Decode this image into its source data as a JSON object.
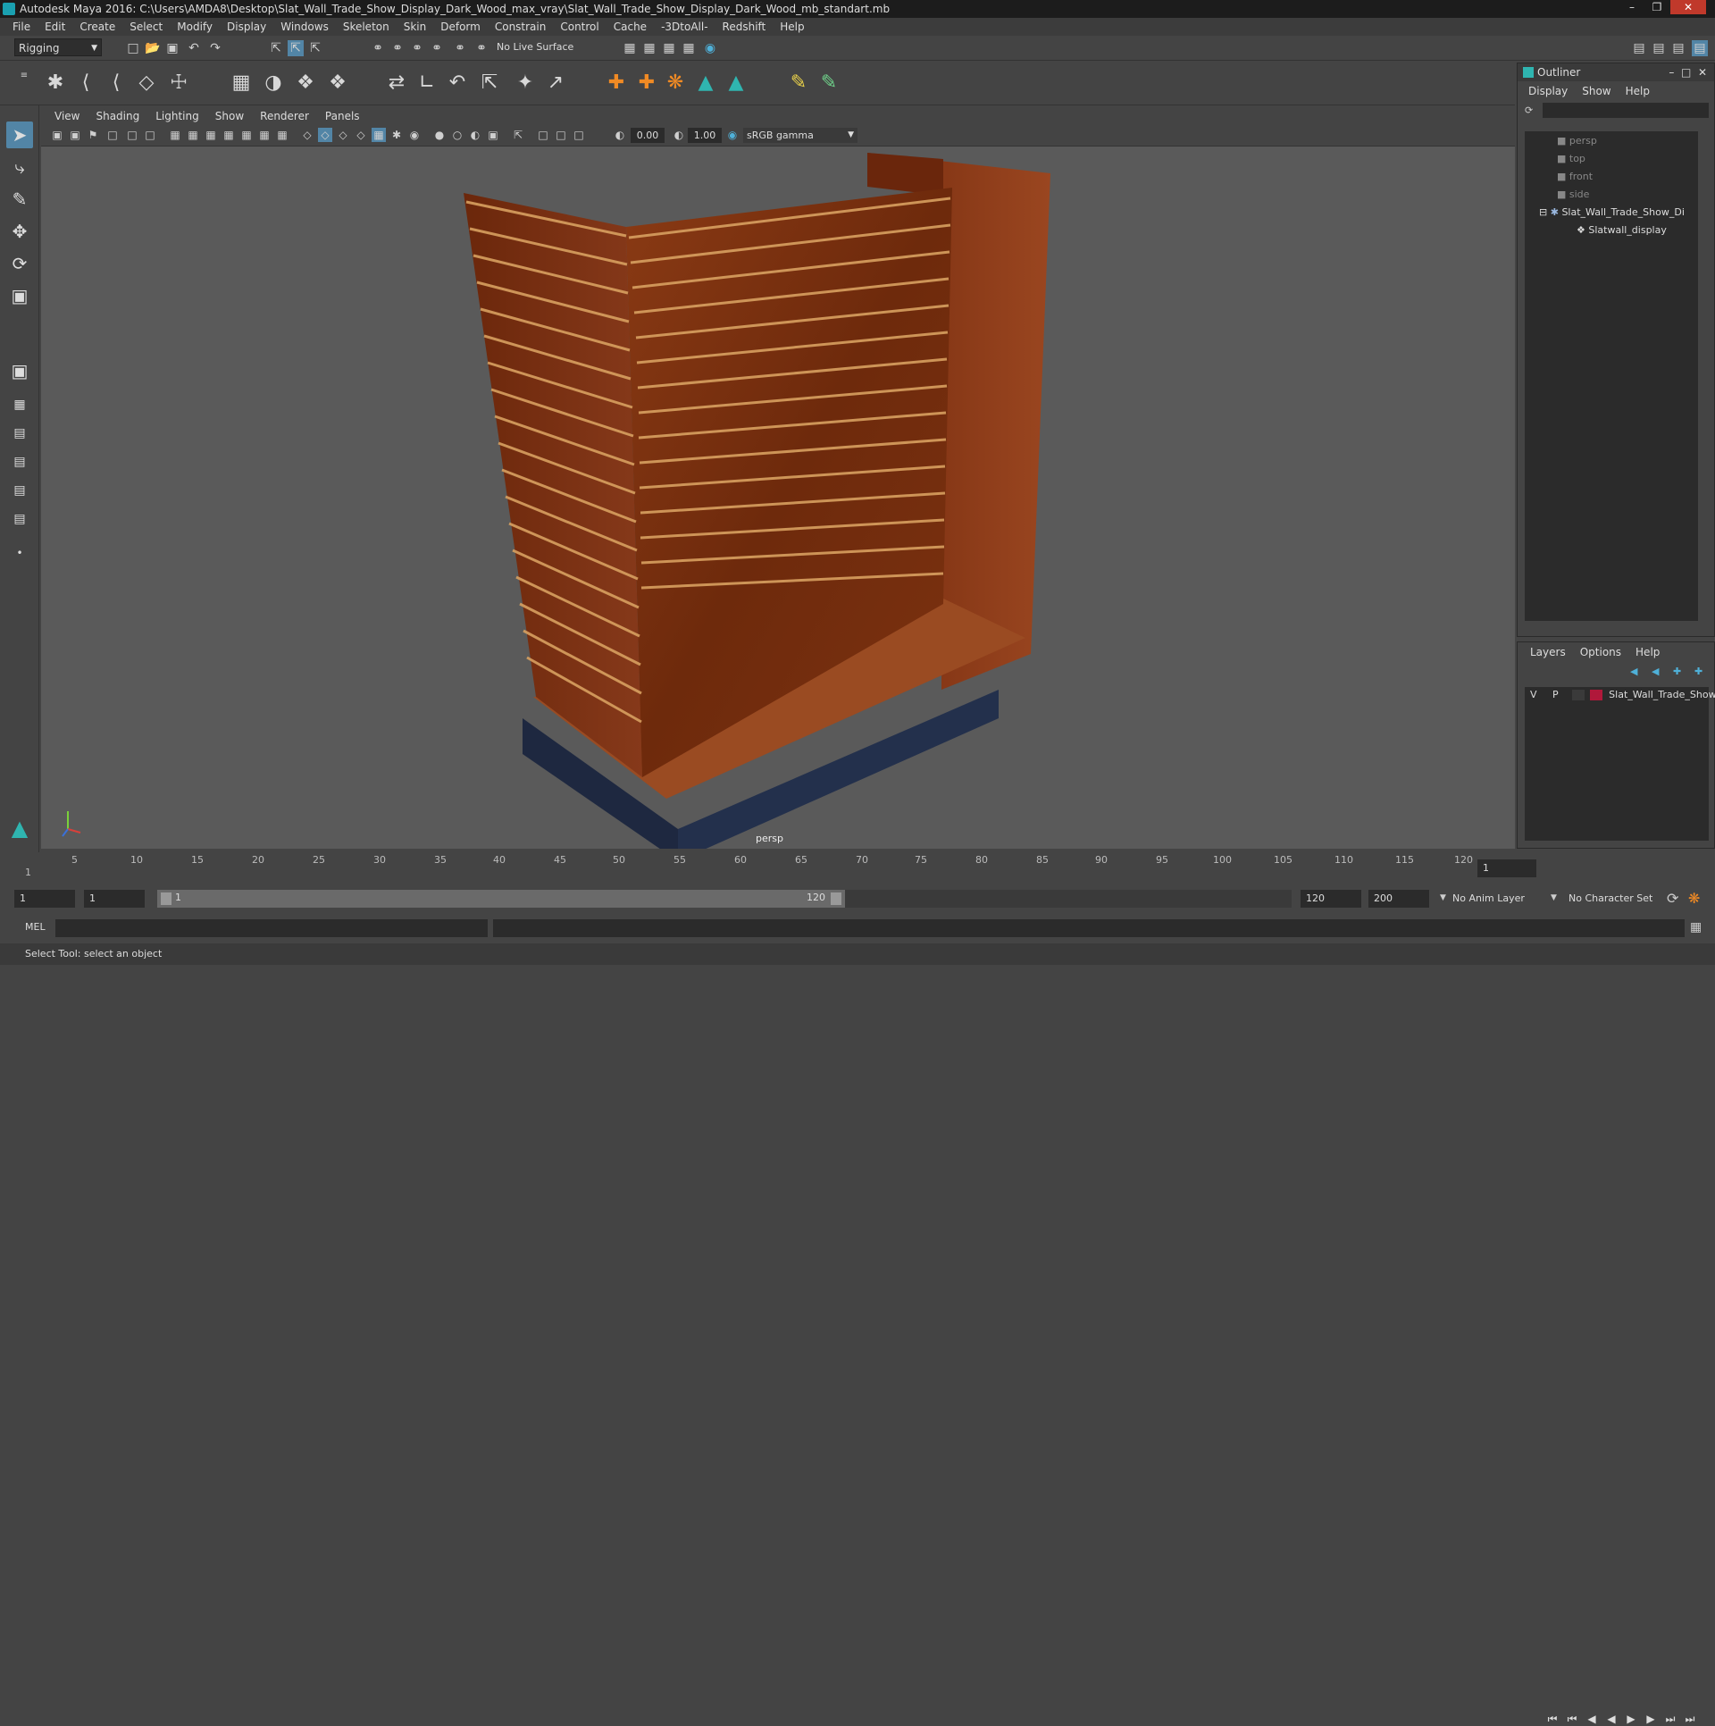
{
  "window": {
    "title": "Autodesk Maya 2016: C:\\Users\\AMDA8\\Desktop\\Slat_Wall_Trade_Show_Display_Dark_Wood_max_vray\\Slat_Wall_Trade_Show_Display_Dark_Wood_mb_standart.mb"
  },
  "menubar": [
    "File",
    "Edit",
    "Create",
    "Select",
    "Modify",
    "Display",
    "Windows",
    "Skeleton",
    "Skin",
    "Deform",
    "Constrain",
    "Control",
    "Cache",
    "-3DtoAll-",
    "Redshift",
    "Help"
  ],
  "shelf": {
    "mode": "Rigging",
    "live_surface": "No Live Surface"
  },
  "viewport": {
    "menu": [
      "View",
      "Shading",
      "Lighting",
      "Show",
      "Renderer",
      "Panels"
    ],
    "exposure": "0.00",
    "gamma": "1.00",
    "color_space": "sRGB gamma",
    "camera_label": "persp"
  },
  "outliner": {
    "title": "Outliner",
    "menu": [
      "Display",
      "Show",
      "Help"
    ],
    "items": [
      {
        "label": "persp",
        "dim": true
      },
      {
        "label": "top",
        "dim": true
      },
      {
        "label": "front",
        "dim": true
      },
      {
        "label": "side",
        "dim": true
      },
      {
        "label": "Slat_Wall_Trade_Show_Di",
        "dim": false
      },
      {
        "label": "Slatwall_display",
        "dim": false
      }
    ]
  },
  "layers": {
    "menu": [
      "Layers",
      "Options",
      "Help"
    ],
    "row": {
      "v": "V",
      "p": "P",
      "name": "Slat_Wall_Trade_Show",
      "color": "#b0183a"
    }
  },
  "timeline": {
    "ticks": [
      "1",
      "5",
      "10",
      "15",
      "20",
      "25",
      "30",
      "35",
      "40",
      "45",
      "50",
      "55",
      "60",
      "65",
      "70",
      "75",
      "80",
      "85",
      "90",
      "95",
      "100",
      "105",
      "110",
      "115",
      "120"
    ],
    "current_frame": "1"
  },
  "range": {
    "start": "1",
    "playback_start": "1",
    "slider_start": "1",
    "slider_end": "120",
    "playback_end": "120",
    "end": "200",
    "anim_layer": "No Anim Layer",
    "char_set": "No Character Set"
  },
  "cmd": {
    "lang": "MEL"
  },
  "status": {
    "text": "Select Tool: select an object"
  },
  "colors": {
    "accent": "#5285a6",
    "wood": "#7a2e10"
  }
}
